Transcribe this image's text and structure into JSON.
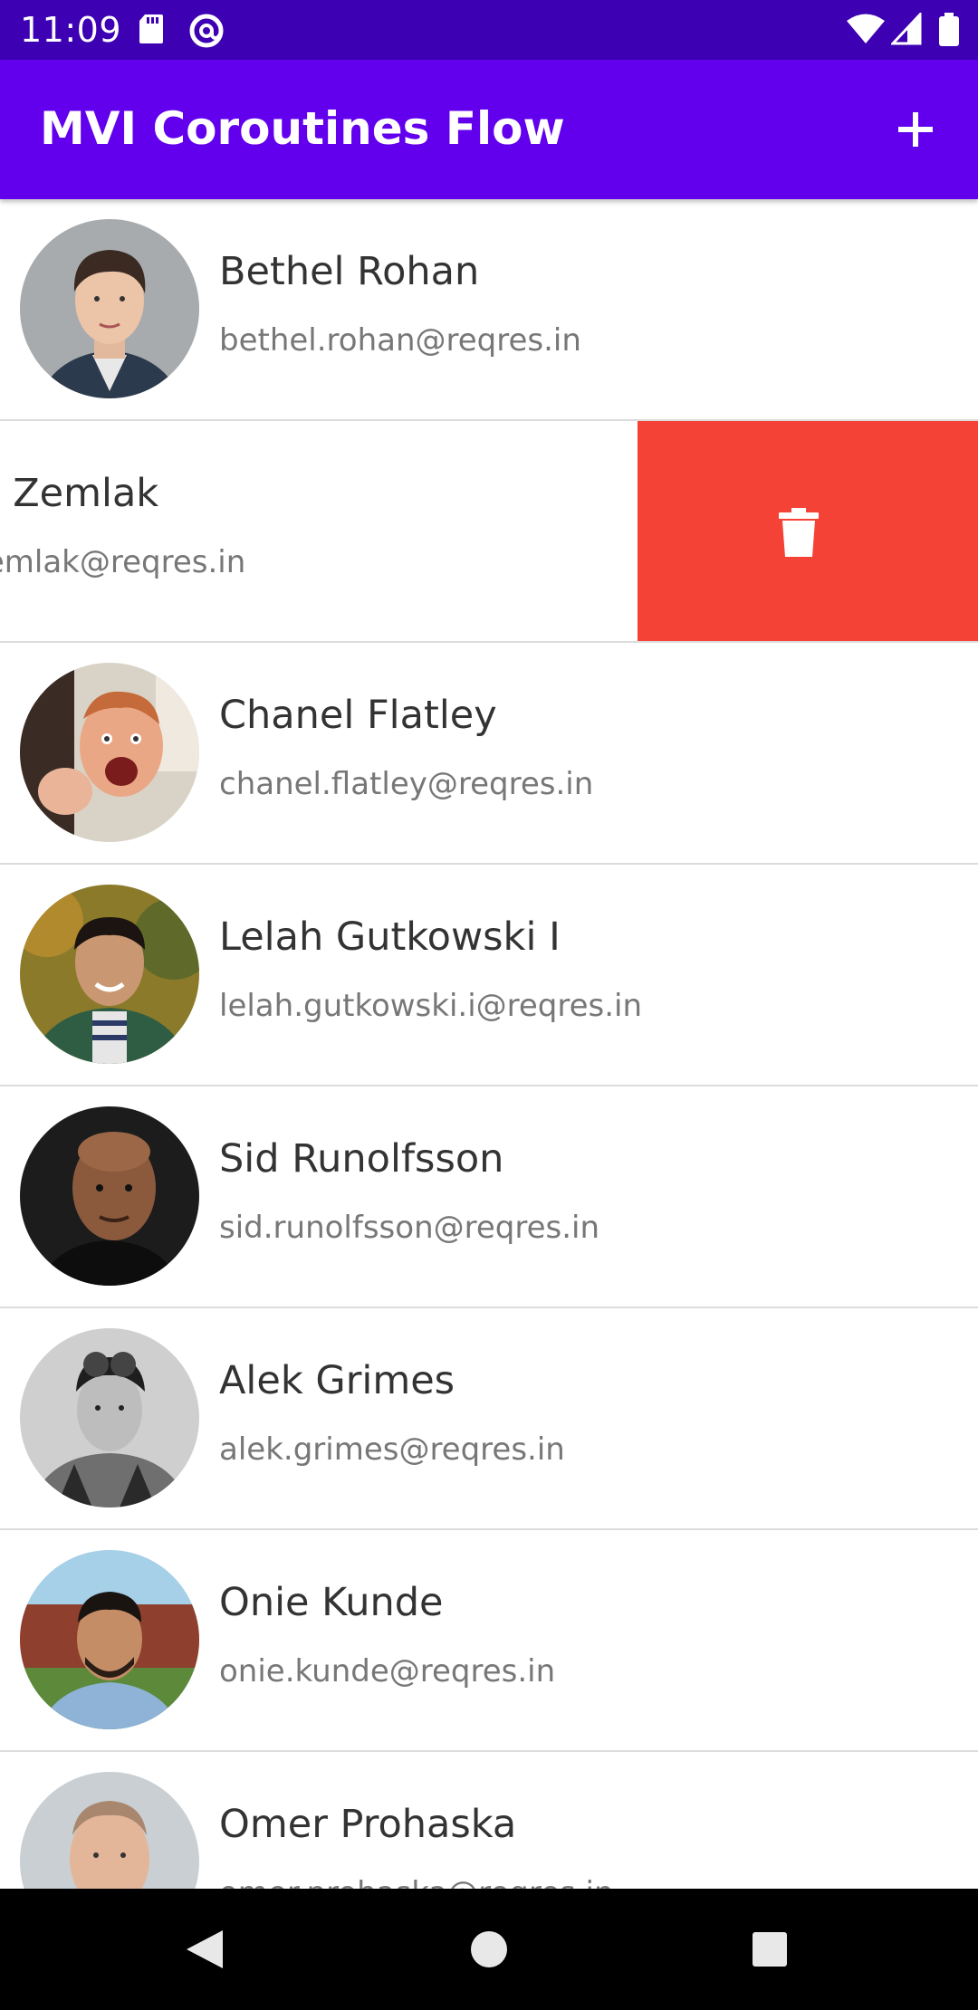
{
  "status_bar": {
    "time": "11:09",
    "left_icons": [
      "sd-card-icon",
      "at-sign-icon"
    ],
    "right_icons": [
      "wifi-icon",
      "signal-icon",
      "battery-icon"
    ]
  },
  "app_bar": {
    "title": "MVI Coroutines Flow",
    "action_icon": "add-icon",
    "background_color": "#6200ee"
  },
  "users": [
    {
      "name": "Bethel Rohan",
      "email": "bethel.rohan@reqres.in",
      "avatar": "bethel-avatar"
    },
    {
      "name": "rt Zemlak",
      "email": "zemlak@reqres.in",
      "swiped": true,
      "action_icon": "trash-icon",
      "action_color": "#f44336"
    },
    {
      "name": "Chanel Flatley",
      "email": "chanel.flatley@reqres.in",
      "avatar": "chanel-avatar"
    },
    {
      "name": "Lelah Gutkowski I",
      "email": "lelah.gutkowski.i@reqres.in",
      "avatar": "lelah-avatar"
    },
    {
      "name": "Sid Runolfsson",
      "email": "sid.runolfsson@reqres.in",
      "avatar": "sid-avatar"
    },
    {
      "name": "Alek Grimes",
      "email": "alek.grimes@reqres.in",
      "avatar": "alek-avatar"
    },
    {
      "name": "Onie Kunde",
      "email": "onie.kunde@reqres.in",
      "avatar": "onie-avatar"
    },
    {
      "name": "Omer Prohaska",
      "email": "omer.prohaska@reqres.in",
      "avatar": "omer-avatar"
    }
  ],
  "nav_bar": {
    "buttons": [
      "back-icon",
      "home-icon",
      "recents-icon"
    ]
  }
}
